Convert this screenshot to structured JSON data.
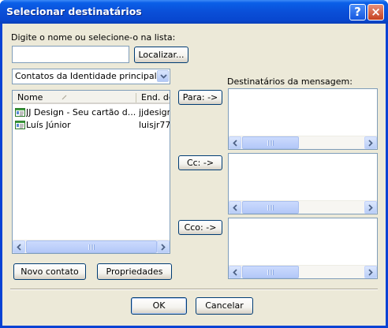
{
  "window": {
    "title": "Selecionar destinatários",
    "help_label": "?",
    "close_label": "×"
  },
  "search": {
    "label": "Digite o nome ou selecione-o na lista:",
    "value": "",
    "find_button": "Localizar..."
  },
  "address_book": {
    "selected": "Contatos da Identidade principal"
  },
  "contacts": {
    "columns": [
      "Nome",
      "End. de"
    ],
    "rows": [
      {
        "name": "JJ Design - Seu cartão d...",
        "email": "jjdesignc"
      },
      {
        "name": "Luís Júnior",
        "email": "luisjr77@"
      }
    ]
  },
  "actions": {
    "new_contact": "Novo contato",
    "properties": "Propriedades"
  },
  "recipients": {
    "label": "Destinatários da mensagem:",
    "to_button": "Para: ->",
    "cc_button": "Cc: ->",
    "bcc_button": "Cco: ->"
  },
  "footer": {
    "ok": "OK",
    "cancel": "Cancelar"
  },
  "colors": {
    "titlebar": "#0a4fd8",
    "dialog_bg": "#ece9d8",
    "close_button": "#c6411f"
  }
}
